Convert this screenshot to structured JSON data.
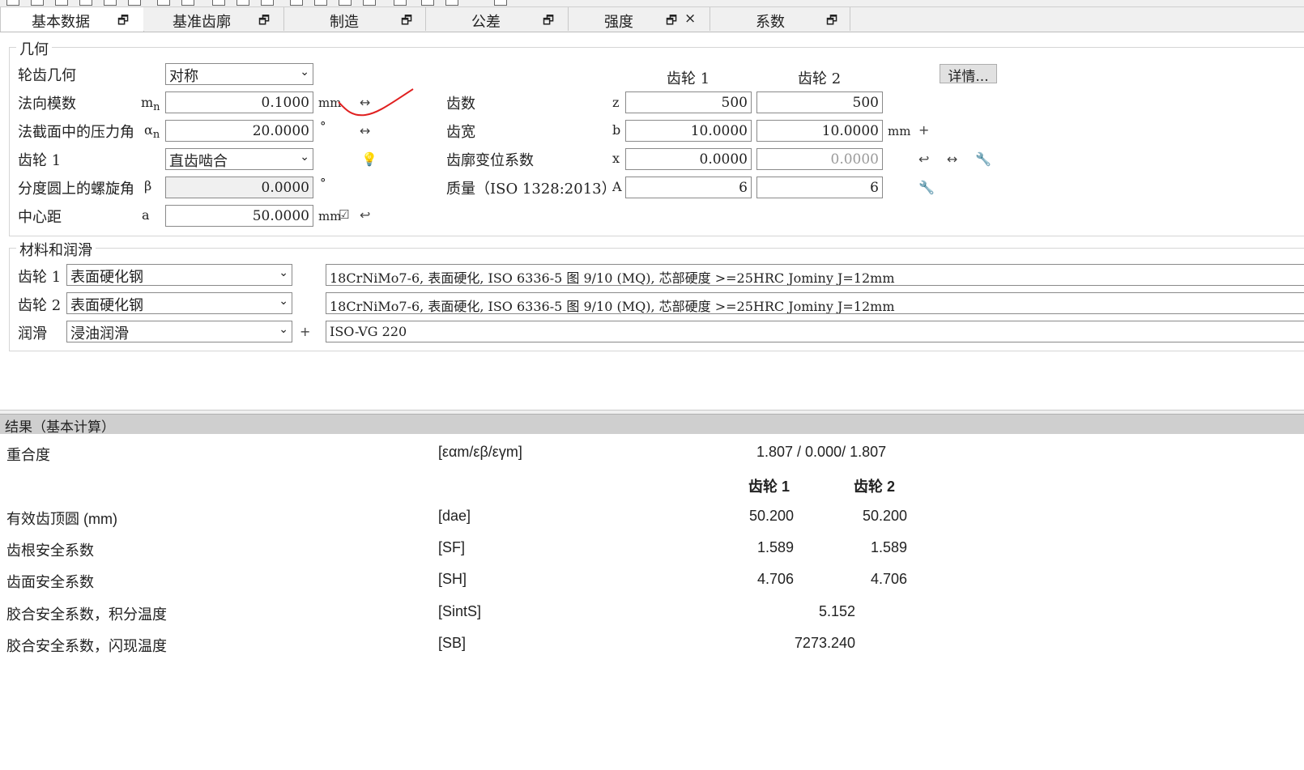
{
  "tabs": [
    {
      "label": "基本数据",
      "icon": "restore-icon"
    },
    {
      "label": "基准齿廓",
      "icon": "restore-icon"
    },
    {
      "label": "制造",
      "icon": "restore-icon"
    },
    {
      "label": "公差",
      "icon": "restore-icon"
    },
    {
      "label": "强度",
      "icon": "restore-icon",
      "close": "×"
    },
    {
      "label": "系数",
      "icon": "restore-icon"
    }
  ],
  "geometry": {
    "title": "几何",
    "tooth_geometry_label": "轮齿几何",
    "tooth_geometry_value": "对称",
    "normal_module_label": "法向模数",
    "normal_module_symbol": "m",
    "normal_module_sub": "n",
    "normal_module_value": "0.1000",
    "normal_module_unit": "mm",
    "pressure_angle_label": "法截面中的压力角",
    "pressure_angle_symbol": "α",
    "pressure_angle_sub": "n",
    "pressure_angle_value": "20.0000",
    "pressure_angle_unit": "°",
    "gear1_label": "齿轮 1",
    "gear1_value": "直齿啮合",
    "helix_label": "分度圆上的螺旋角",
    "helix_symbol": "β",
    "helix_value": "0.0000",
    "helix_unit": "°",
    "center_label": "中心距",
    "center_symbol": "a",
    "center_value": "50.0000",
    "center_unit": "mm",
    "col_gear1": "齿轮 1",
    "col_gear2": "齿轮 2",
    "details_button": "详情...",
    "teeth_label": "齿数",
    "teeth_symbol": "z",
    "teeth_g1": "500",
    "teeth_g2": "500",
    "width_label": "齿宽",
    "width_symbol": "b",
    "width_g1": "10.0000",
    "width_g2": "10.0000",
    "width_unit": "mm",
    "shift_label": "齿廓变位系数",
    "shift_symbol": "x",
    "shift_g1": "0.0000",
    "shift_g2": "0.0000",
    "quality_label": "质量（ISO 1328:2013）",
    "quality_symbol": "A",
    "quality_g1": "6",
    "quality_g2": "6"
  },
  "materials": {
    "title": "材料和润滑",
    "gear1_label": "齿轮 1",
    "gear1_type": "表面硬化钢",
    "gear1_material": "18CrNiMo7-6, 表面硬化, ISO 6336-5 图 9/10 (MQ), 芯部硬度 >=25HRC Jominy J=12mm",
    "gear2_label": "齿轮 2",
    "gear2_type": "表面硬化钢",
    "gear2_material": "18CrNiMo7-6, 表面硬化, ISO 6336-5 图 9/10 (MQ), 芯部硬度 >=25HRC Jominy J=12mm",
    "lube_label": "润滑",
    "lube_type": "浸油润滑",
    "lube_oil": "ISO-VG 220"
  },
  "results": {
    "header": "结果（基本计算）",
    "contact_label": "重合度",
    "contact_symbol": "[εαm/εβ/εγm]",
    "contact_value": "1.807 /  0.000/ 1.807",
    "col_gear1": "齿轮 1",
    "col_gear2": "齿轮 2",
    "rows": [
      {
        "label": "有效齿顶圆 (mm)",
        "symbol": "[dae]",
        "g1": "50.200",
        "g2": "50.200"
      },
      {
        "label": "齿根安全系数",
        "symbol": "[SF]",
        "g1": "1.589",
        "g2": "1.589"
      },
      {
        "label": "齿面安全系数",
        "symbol": "[SH]",
        "g1": "4.706",
        "g2": "4.706"
      }
    ],
    "scuff_int_label": "胶合安全系数，积分温度",
    "scuff_int_symbol": "[SintS]",
    "scuff_int_value": "5.152",
    "scuff_flash_label": "胶合安全系数，闪现温度",
    "scuff_flash_symbol": "[SB]",
    "scuff_flash_value": "7273.240"
  },
  "annotation_color": "#e02020"
}
